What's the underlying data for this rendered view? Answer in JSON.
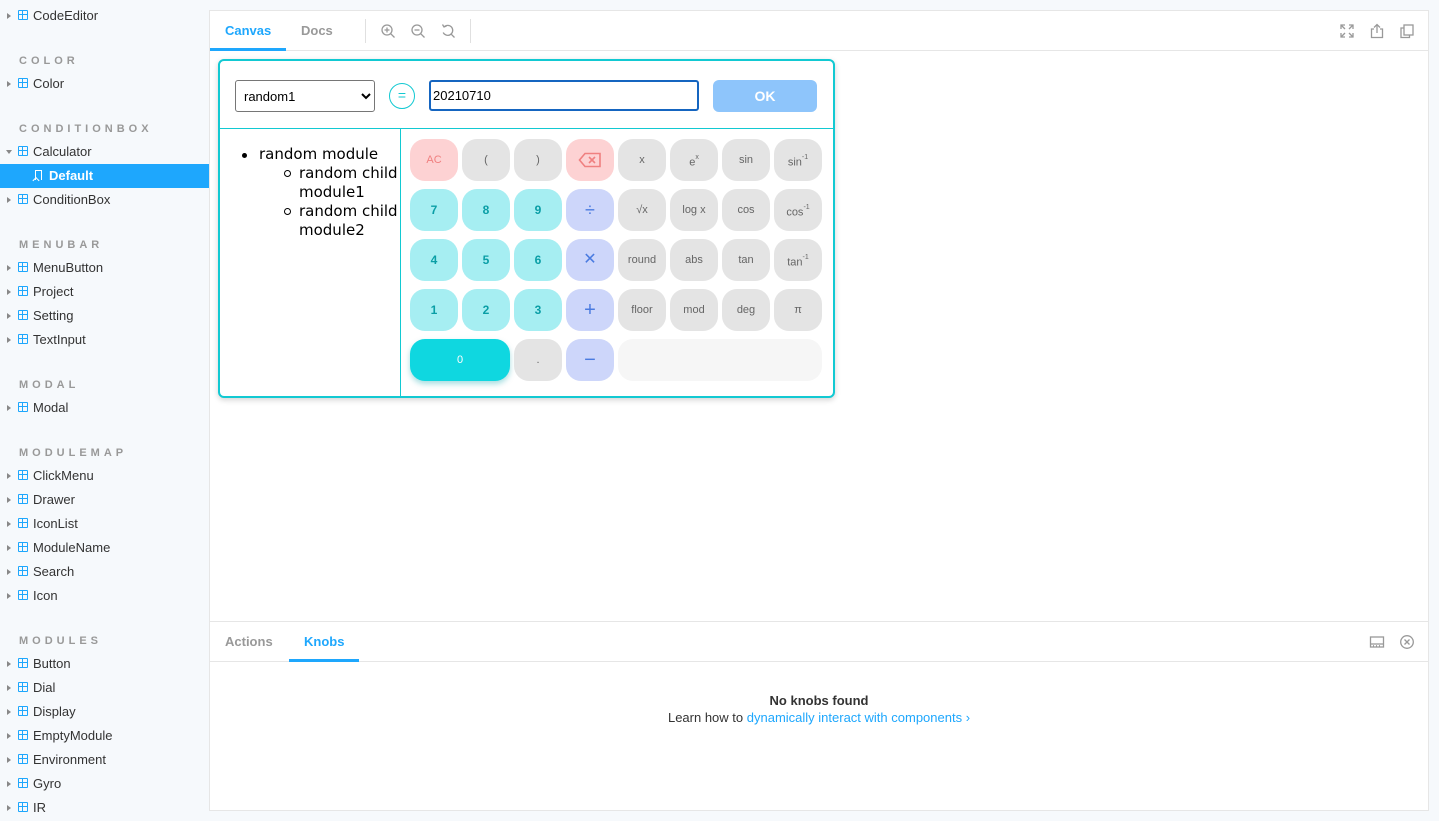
{
  "sidebar": {
    "top_items": [
      "CodeEditor"
    ],
    "sections": [
      {
        "heading": "COLOR",
        "items": [
          "Color"
        ]
      },
      {
        "heading": "CONDITIONBOX",
        "items": [
          "Calculator",
          "Default",
          "ConditionBox"
        ]
      },
      {
        "heading": "MENUBAR",
        "items": [
          "MenuButton",
          "Project",
          "Setting",
          "TextInput"
        ]
      },
      {
        "heading": "MODAL",
        "items": [
          "Modal"
        ]
      },
      {
        "heading": "MODULEMAP",
        "items": [
          "ClickMenu",
          "Drawer",
          "IconList",
          "ModuleName",
          "Search",
          "Icon"
        ]
      },
      {
        "heading": "MODULES",
        "items": [
          "Button",
          "Dial",
          "Display",
          "EmptyModule",
          "Environment",
          "Gyro",
          "IR"
        ]
      }
    ],
    "selected_story": "Default"
  },
  "toolbar": {
    "tabs": [
      "Canvas",
      "Docs"
    ],
    "active_tab": "Canvas",
    "icons": [
      "zoom-in-icon",
      "zoom-out-icon",
      "zoom-reset-icon",
      "fullscreen-icon",
      "share-icon",
      "copy-icon"
    ]
  },
  "calculator": {
    "module_select": {
      "selected": "random1",
      "options": [
        "random1"
      ]
    },
    "equals_symbol": "=",
    "value": "20210710",
    "ok_label": "OK",
    "module_tree": {
      "root": "random module",
      "children": [
        "random child module1",
        "random child module2"
      ]
    },
    "keys": {
      "ac": "AC",
      "lparen": "(",
      "rparen": ")",
      "x": "x",
      "exp": "e",
      "exp_sup": "x",
      "sin": "sin",
      "asin": "sin",
      "inv_sup": "-1",
      "sqrt": "√x",
      "log": "log x",
      "cos": "cos",
      "acos": "cos",
      "round": "round",
      "abs": "abs",
      "tan": "tan",
      "atan": "tan",
      "floor": "floor",
      "mod": "mod",
      "deg": "deg",
      "pi": "π",
      "divide": "÷",
      "multiply": "✕",
      "plus": "+",
      "minus": "−",
      "dot": ".",
      "d7": "7",
      "d8": "8",
      "d9": "9",
      "d4": "4",
      "d5": "5",
      "d6": "6",
      "d1": "1",
      "d2": "2",
      "d3": "3",
      "d0": "0"
    },
    "colors": {
      "accent": "#12c9d2",
      "ok_button": "#8ec5fb",
      "number_key": "#a6eef2",
      "operator_key": "#cdd6fa",
      "clear_key": "#fdd2d3"
    }
  },
  "addons": {
    "tabs": [
      "Actions",
      "Knobs"
    ],
    "active_tab": "Knobs",
    "empty_title": "No knobs found",
    "learn_prefix": "Learn how to",
    "learn_link": "dynamically interact with components ›"
  },
  "colors": {
    "brand": "#1ea7fd"
  }
}
